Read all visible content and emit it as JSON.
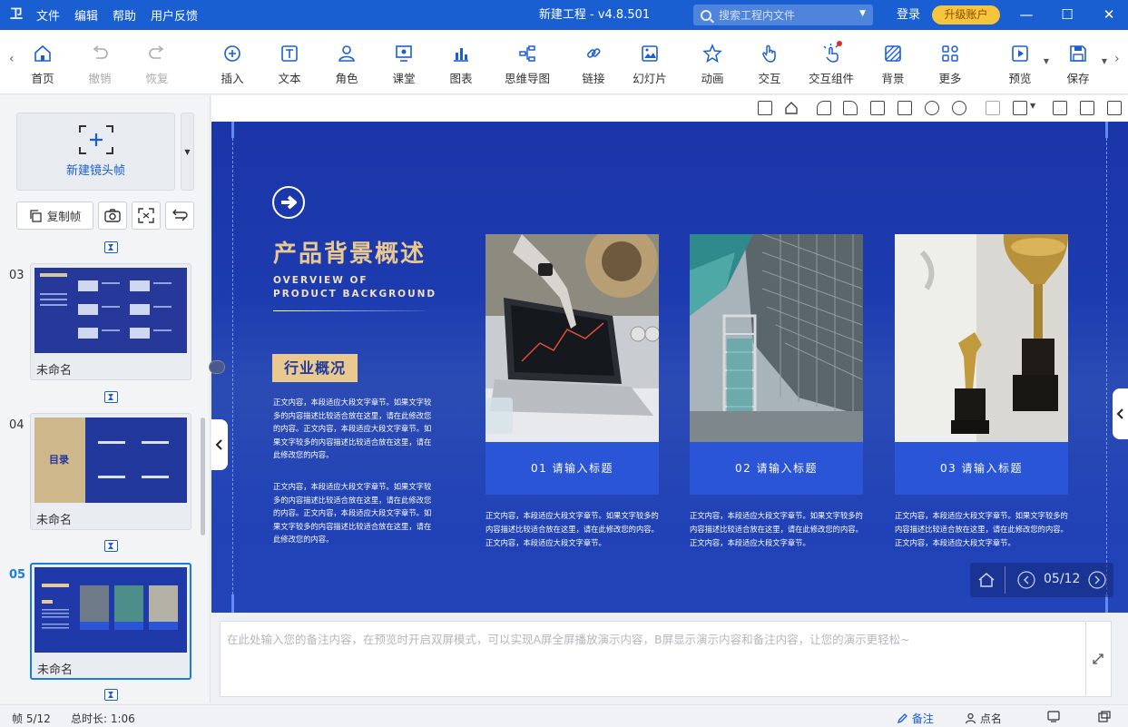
{
  "app": {
    "logo": "卫",
    "menu": [
      "文件",
      "编辑",
      "帮助",
      "用户反馈"
    ],
    "window_title": "新建工程 - v4.8.501",
    "search_placeholder": "搜索工程内文件",
    "login": "登录",
    "upgrade": "升级账户"
  },
  "toolbar": {
    "items": [
      {
        "label": "首页",
        "icon": "home-icon"
      },
      {
        "label": "撤销",
        "icon": "undo-icon"
      },
      {
        "label": "恢复",
        "icon": "redo-icon"
      },
      {
        "label": "插入",
        "icon": "plus-circle-icon"
      },
      {
        "label": "文本",
        "icon": "text-icon"
      },
      {
        "label": "角色",
        "icon": "person-icon"
      },
      {
        "label": "课堂",
        "icon": "classroom-icon"
      },
      {
        "label": "图表",
        "icon": "chart-icon"
      },
      {
        "label": "思维导图",
        "icon": "mindmap-icon"
      },
      {
        "label": "链接",
        "icon": "link-icon"
      },
      {
        "label": "幻灯片",
        "icon": "slide-icon"
      },
      {
        "label": "动画",
        "icon": "star-icon"
      },
      {
        "label": "交互",
        "icon": "hand-icon"
      },
      {
        "label": "交互组件",
        "icon": "touch-icon"
      },
      {
        "label": "背景",
        "icon": "background-icon"
      },
      {
        "label": "更多",
        "icon": "grid-icon"
      },
      {
        "label": "预览",
        "icon": "play-icon"
      },
      {
        "label": "保存",
        "icon": "save-icon"
      }
    ]
  },
  "left": {
    "new_frame": "新建镜头帧",
    "copy_frame": "复制帧",
    "slides": [
      {
        "num": "03",
        "caption": "未命名"
      },
      {
        "num": "04",
        "caption": "未命名"
      },
      {
        "num": "05",
        "caption": "未命名"
      }
    ],
    "thumb04_title": "目录"
  },
  "slide": {
    "title": "产品背景概述",
    "subtitle_line1": "OVERVIEW OF",
    "subtitle_line2": "PRODUCT BACKGROUND",
    "tag": "行业概况",
    "para1": "正文内容，本段适应大段文字章节。如果文字较多的内容描述比较适合放在这里，请在此修改您的内容。正文内容，本段适应大段文字章节。如果文字较多的内容描述比较适合放在这里，请在此修改您的内容。",
    "para2": "正文内容，本段适应大段文字章节。如果文字较多的内容描述比较适合放在这里，请在此修改您的内容。正文内容，本段适应大段文字章节。如果文字较多的内容描述比较适合放在这里，请在此修改您的内容。",
    "cards": [
      {
        "title": "01 请输入标题",
        "text": "正文内容，本段适应大段文字章节。如果文字较多的内容描述比较适合放在这里，请在此修改您的内容。正文内容，本段适应大段文字章节。"
      },
      {
        "title": "02 请输入标题",
        "text": "正文内容，本段适应大段文字章节。如果文字较多的内容描述比较适合放在这里，请在此修改您的内容。正文内容，本段适应大段文字章节。"
      },
      {
        "title": "03 请输入标题",
        "text": "正文内容，本段适应大段文字章节。如果文字较多的内容描述比较适合放在这里，请在此修改您的内容。正文内容，本段适应大段文字章节。"
      }
    ],
    "pager": "05/12"
  },
  "notes_placeholder": "在此处输入您的备注内容，在预览时开启双屏模式，可以实现A屏全屏播放演示内容，B屏显示演示内容和备注内容，让您的演示更轻松~",
  "status": {
    "frame": "帧 5/12",
    "duration": "总时长: 1:06",
    "notes": "备注",
    "rollcall": "点名"
  },
  "colors": {
    "brand": "#1a5fd1",
    "slide_bg": "#1e3fb4",
    "gold": "#e9c98f",
    "card_band": "#2a55d6"
  }
}
